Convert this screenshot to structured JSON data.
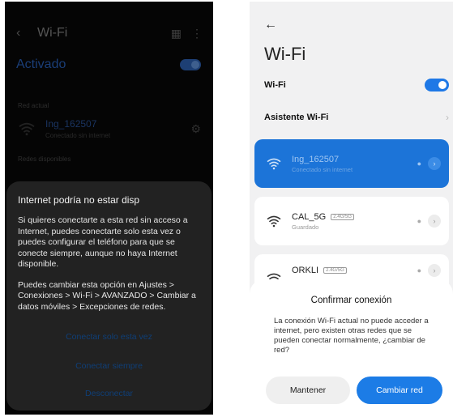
{
  "left": {
    "header": {
      "back_icon": "arrow-left-icon",
      "title": "Wi-Fi",
      "icons": [
        "qr-icon",
        "more-vert-icon"
      ]
    },
    "toggle": {
      "label": "Activado",
      "on": true
    },
    "current_section": "Red actual",
    "current_network": {
      "name": "Ing_162507",
      "status": "Conectado sin internet"
    },
    "available_section": "Redes disponibles",
    "dialog": {
      "title": "Internet podría no estar disp",
      "body": "Si quieres conectarte a esta red sin acceso a Internet, puedes conectarte solo esta vez o puedes configurar el teléfono para que se conecte siempre, aunque no haya Internet disponible.",
      "body2": "Puedes cambiar esta opción en Ajustes > Conexiones > Wi-Fi > AVANZADO > Cambiar a datos móviles > Excepciones de redes.",
      "btn_once": "Conectar solo esta vez",
      "btn_always": "Conectar siempre",
      "btn_disconnect": "Desconectar"
    }
  },
  "right": {
    "back_icon": "arrow-left-icon",
    "title": "Wi-Fi",
    "wifi_toggle": {
      "label": "Wi-Fi",
      "on": true
    },
    "assistant": "Asistente Wi-Fi",
    "networks": [
      {
        "name": "Ing_162507",
        "status": "Conectado sin internet",
        "badge": ""
      },
      {
        "name": "CAL_5G",
        "status": "Guardado",
        "badge": "2.4G/5G"
      },
      {
        "name": "ORKLI",
        "status": "",
        "badge": "2.4G/5G"
      }
    ],
    "dialog": {
      "title": "Confirmar conexión",
      "body": "La conexión Wi-Fi actual no puede acceder a internet, pero existen otras redes que se pueden conectar normalmente, ¿cambiar de red?",
      "keep": "Mantener",
      "change": "Cambiar red"
    },
    "colors": {
      "accent": "#1c74d8",
      "toggle": "#1e78e6"
    }
  }
}
